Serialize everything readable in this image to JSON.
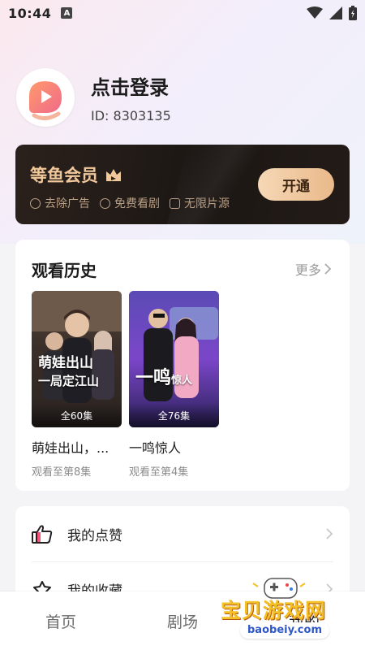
{
  "status_bar": {
    "time": "10:44",
    "notification_glyph": "A"
  },
  "profile": {
    "title": "点击登录",
    "id_text": "ID: 8303135"
  },
  "vip": {
    "title": "等鱼会员",
    "perks": [
      "去除广告",
      "免费看剧",
      "无限片源"
    ],
    "button_label": "开通",
    "accent_color": "#f0c89b"
  },
  "history": {
    "title": "观看历史",
    "more_label": "更多",
    "items": [
      {
        "poster_text_line1": "萌娃出山",
        "poster_text_line2": "一局定江山",
        "episodes": "全60集",
        "title": "萌娃出山，...",
        "progress": "观看至第8集"
      },
      {
        "poster_text_line1": "一鸣",
        "poster_text_line2": "惊人",
        "episodes": "全76集",
        "title": "一鸣惊人",
        "progress": "观看至第4集"
      }
    ]
  },
  "menu": {
    "items": [
      {
        "label": "我的点赞",
        "icon": "thumbs-up-icon"
      },
      {
        "label": "我的收藏",
        "icon": "collection-icon"
      }
    ]
  },
  "tabbar": {
    "tabs": [
      "首页",
      "剧场",
      "我的"
    ]
  },
  "watermark": {
    "text": "宝贝游戏网",
    "url": "baobeiy.com"
  }
}
